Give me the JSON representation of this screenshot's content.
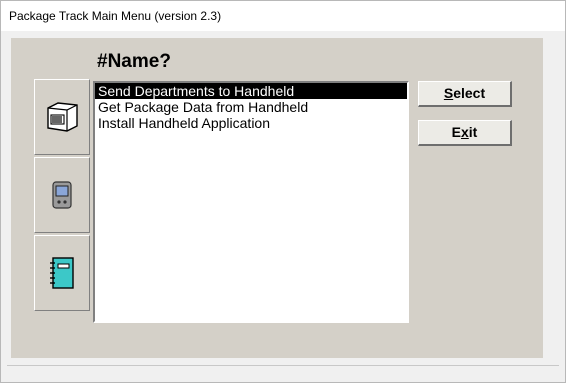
{
  "window": {
    "title": "Package Track Main Menu (version 2.3)"
  },
  "heading": "#Name?",
  "list": {
    "items": [
      "Send Departments to Handheld",
      "Get Package Data from Handheld",
      "Install Handheld Application"
    ],
    "selected_index": 0
  },
  "buttons": {
    "select": {
      "label": "Select",
      "accel_pre": "",
      "accel": "S",
      "accel_post": "elect"
    },
    "exit": {
      "label": "Exit",
      "accel_pre": "E",
      "accel": "x",
      "accel_post": "it"
    }
  },
  "sidebar": {
    "icons": [
      "barcode-scanner-icon",
      "handheld-device-icon",
      "notebook-icon"
    ]
  },
  "colors": {
    "client_bg": "#d4d0c8",
    "selection_bg": "#000000",
    "notebook": "#3cc8c8"
  }
}
